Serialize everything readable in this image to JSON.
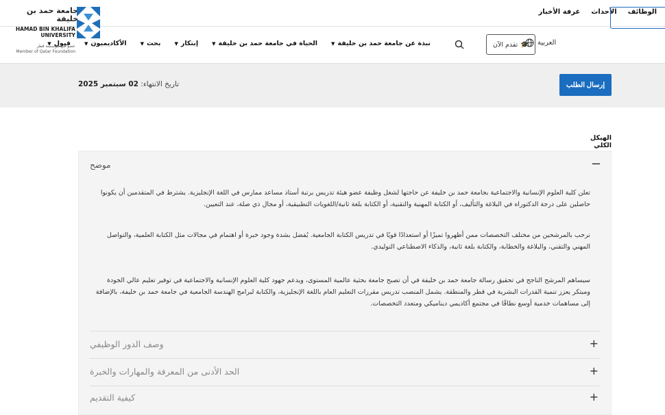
{
  "top_nav": [
    "الوظائف",
    "الأحداث",
    "غرفة الأخبار"
  ],
  "logo": {
    "arabic_name": "جامعة حمد بن خليفة",
    "english_name": "HAMAD BIN KHALIFA UNIVERSITY",
    "member_ar": "عضو في مؤسسة قطر",
    "member_en": "Member of Qatar Foundation"
  },
  "header": {
    "apply_now": "تقدم الآن",
    "language": "العربية",
    "menu": [
      "نبذة عن جامعة حمد بن خليفة",
      "الحياة في جامعة حمد بن خليفة",
      "إبتكار",
      "بحث",
      "الأكاديميون",
      "قبول"
    ]
  },
  "application_bar": {
    "submit_label": "إرسال الطلب",
    "deadline_label": "تاريخ الانتهاء:",
    "deadline_value": "02 سبتمبر 2025"
  },
  "content": {
    "section_title": "الهيكل الكلي",
    "accordion": [
      {
        "label": "موضح",
        "toggle": "−",
        "paragraphs": [
          "تعلن كلية العلوم الإنسانية والاجتماعية بجامعة حمد بن خليفة عن حاجتها لشغل وظيفة عضو هيئة تدريس برتبة أستاذ مساعد ممارس في اللغة الإنجليزية. يشترط في المتقدمين أن يكونوا حاصلين على درجة الدكتوراه في البلاغة والتأليف، أو الكتابة المهنية والتقنية، أو الكتابة بلغة ثانية/اللغويات التطبيقية، أو مجال ذي صلة، عند التعيين.",
          "نرحب بالمرشحين من مختلف التخصصات ممن أظهروا تميزًا أو استعدادًا قويًا في تدريس الكتابة الجامعية. يُفضل بشدة وجود خبرة أو اهتمام في مجالات مثل الكتابة العلمية، والتواصل المهني والتقني، والبلاغة والخطابة، والكتابة بلغة ثانية، والذكاء الاصطناعي التوليدي.",
          "سيساهم المرشح الناجح في تحقيق رسالة جامعة حمد بن خليفة في أن تصبح جامعة بحثية عالمية المستوى، ويدعم جهود كلية العلوم الإنسانية والاجتماعية في توفير تعليم عالي الجودة ومبتكر يعزز تنمية القدرات البشرية في قطر والمنطقة. يشمل المنصب تدريس مقررات التعليم العام باللغة الإنجليزية، والكتابة لبرامج الهندسة الجامعية في جامعة حمد بن خليفة، بالإضافة إلى مساهمات خدمية أوسع نطاقًا في مجتمع أكاديمي ديناميكي ومتعدد التخصصات."
        ]
      },
      {
        "label": "وصف الدور الوظيفي",
        "toggle": "+"
      },
      {
        "label": "الحد الأدنى من المعرفة والمهارات والخبرة",
        "toggle": "+"
      },
      {
        "label": "كيفية التقديم",
        "toggle": "+"
      }
    ]
  },
  "colors": {
    "brand_blue": "#1a6dbf",
    "gray_bar": "#efefef",
    "panel_bg": "#f4f4f4"
  }
}
